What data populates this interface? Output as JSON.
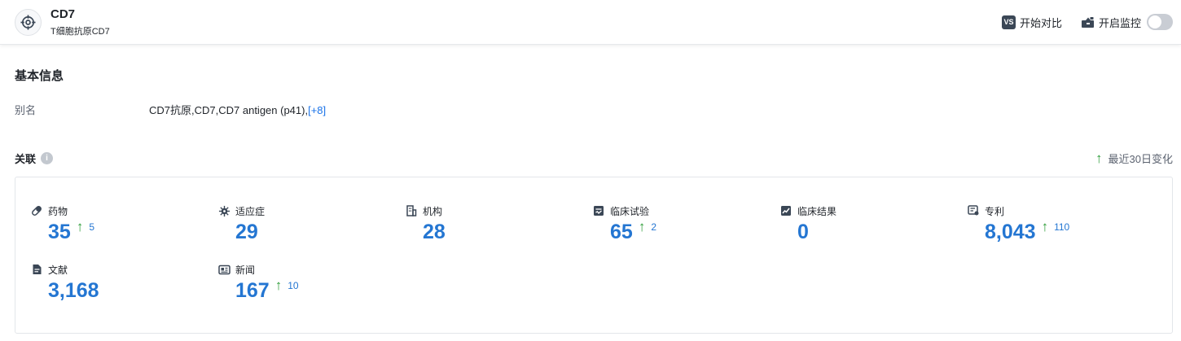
{
  "header": {
    "title": "CD7",
    "subtitle": "T细胞抗原CD7",
    "compare_label": "开始对比",
    "compare_icon_text": "VS",
    "monitor_label": "开启监控",
    "monitor_on": false
  },
  "basic_info": {
    "title": "基本信息",
    "alias_label": "别名",
    "alias_value": "CD7抗原,CD7,CD7 antigen (p41),",
    "alias_more": "[+8]"
  },
  "related": {
    "title": "关联",
    "recent_change_label": "最近30日变化",
    "items": [
      {
        "label": "药物",
        "value": "35",
        "delta": "5",
        "icon": "pill-icon"
      },
      {
        "label": "适应症",
        "value": "29",
        "delta": "",
        "icon": "virus-icon"
      },
      {
        "label": "机构",
        "value": "28",
        "delta": "",
        "icon": "building-icon"
      },
      {
        "label": "临床试验",
        "value": "65",
        "delta": "2",
        "icon": "clinical-trial-icon"
      },
      {
        "label": "临床结果",
        "value": "0",
        "delta": "",
        "icon": "clinical-result-icon"
      },
      {
        "label": "专利",
        "value": "8,043",
        "delta": "110",
        "icon": "patent-icon"
      },
      {
        "label": "文献",
        "value": "3,168",
        "delta": "",
        "icon": "document-icon"
      },
      {
        "label": "新闻",
        "value": "167",
        "delta": "10",
        "icon": "news-icon"
      }
    ]
  },
  "colors": {
    "accent": "#2476d2",
    "up_arrow": "#2e9d3a"
  }
}
